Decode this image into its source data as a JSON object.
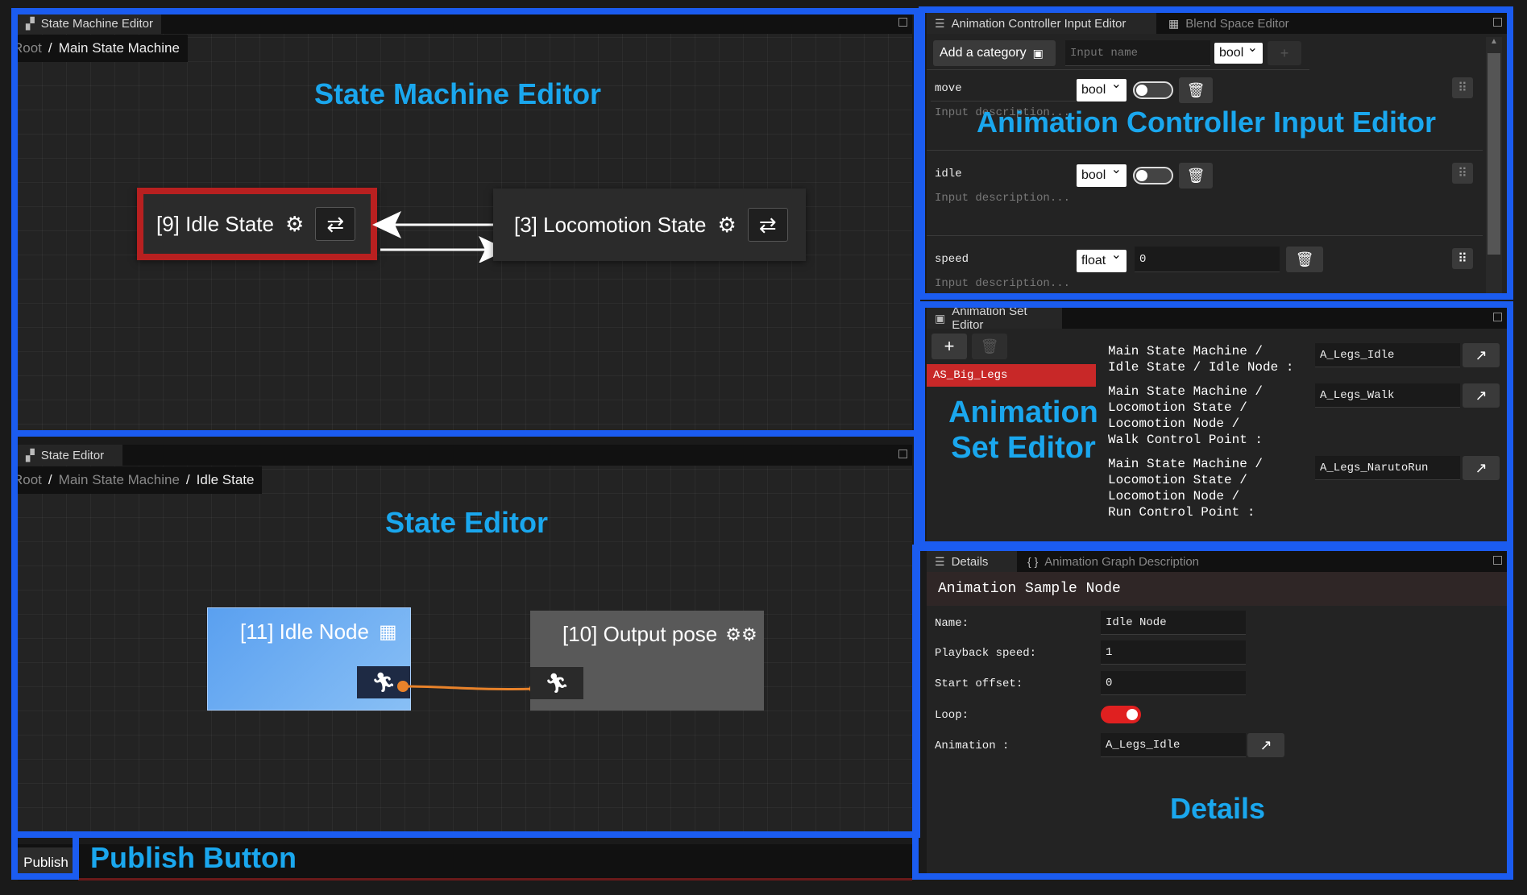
{
  "state_machine_editor": {
    "tab_title": "State Machine Editor",
    "breadcrumb": [
      "Root",
      "Main State Machine"
    ],
    "overlay_label": "State Machine Editor",
    "nodes": [
      {
        "label": "[9] Idle State",
        "selected": true
      },
      {
        "label": "[3] Locomotion State",
        "selected": false
      }
    ]
  },
  "state_editor": {
    "tab_title": "State Editor",
    "breadcrumb": [
      "Root",
      "Main State Machine",
      "Idle State"
    ],
    "overlay_label": "State Editor",
    "idle_node_label": "[11] Idle Node",
    "output_pose_label": "[10] Output pose",
    "connection_color": "#e8822a"
  },
  "publish": {
    "button_label": "Publish",
    "overlay_label": "Publish Button"
  },
  "input_editor": {
    "tabs": [
      "Animation Controller Input Editor",
      "Blend Space Editor"
    ],
    "add_category_label": "Add a category",
    "input_name_placeholder": "Input name",
    "new_type": "bool",
    "overlay_label": "Animation Controller Input Editor",
    "desc_placeholder": "Input description...",
    "inputs": [
      {
        "name": "move",
        "type": "bool",
        "value": ""
      },
      {
        "name": "idle",
        "type": "bool",
        "value": ""
      },
      {
        "name": "speed",
        "type": "float",
        "value": "0"
      }
    ]
  },
  "animation_set_editor": {
    "tab_title": "Animation Set Editor",
    "overlay_label": "Animation Set Editor",
    "sets": [
      "AS_Big_Legs"
    ],
    "entries": [
      {
        "path": [
          "Main State Machine /",
          "Idle State / Idle Node :"
        ],
        "animation": "A_Legs_Idle"
      },
      {
        "path": [
          "Main State Machine /",
          "Locomotion State /",
          "Locomotion Node /",
          "Walk Control Point :"
        ],
        "animation": "A_Legs_Walk"
      },
      {
        "path": [
          "Main State Machine /",
          "Locomotion State /",
          "Locomotion Node /",
          "Run Control Point :"
        ],
        "animation": "A_Legs_NarutoRun"
      }
    ]
  },
  "details": {
    "tabs": [
      "Details",
      "Animation Graph Description"
    ],
    "header": "Animation Sample Node",
    "overlay_label": "Details",
    "name_label": "Name:",
    "name_value": "Idle Node",
    "speed_label": "Playback speed:",
    "speed_value": "1",
    "offset_label": "Start offset:",
    "offset_value": "0",
    "loop_label": "Loop:",
    "loop_on": true,
    "animation_label": "Animation :",
    "animation_value": "A_Legs_Idle"
  },
  "colors": {
    "annotation_border": "#1b5cf0",
    "annotation_text": "#1aa7ee",
    "selected_state": "#b82020",
    "idle_node": "#5aa0f0"
  }
}
